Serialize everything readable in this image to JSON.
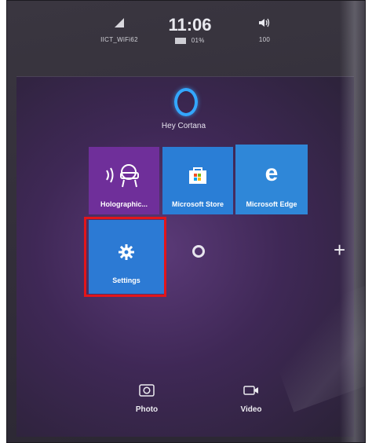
{
  "status": {
    "network_name": "IICT_WiFi62",
    "time": "11:06",
    "battery": "01%",
    "volume": "100"
  },
  "cortana": {
    "label": "Hey Cortana"
  },
  "tiles": {
    "holographic": "Holographic...",
    "store": "Microsoft Store",
    "edge": "Microsoft Edge",
    "settings": "Settings"
  },
  "quick_actions": {
    "photo": "Photo",
    "video": "Video"
  },
  "icons": {
    "wifi": "wifi-icon",
    "battery": "battery-icon",
    "volume": "volume-icon",
    "holographic": "headset-icon",
    "store": "shopping-bag-icon",
    "edge": "edge-icon",
    "settings": "gear-icon",
    "photo": "camera-icon",
    "video": "video-icon",
    "plus": "plus-icon"
  },
  "colors": {
    "cortana_ring": "#33a7ff",
    "tile_blue": "#2c7ad4",
    "tile_purple": "#6f2f9a",
    "highlight": "#e3151a"
  }
}
